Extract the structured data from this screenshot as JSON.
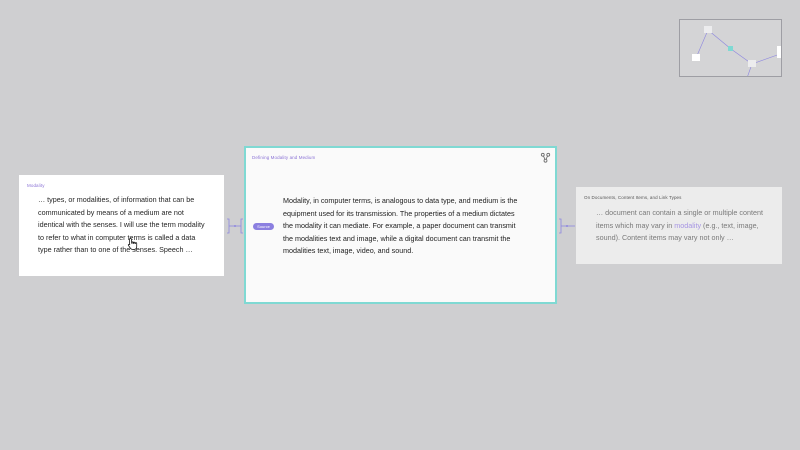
{
  "minimap": {
    "label": "document map"
  },
  "cards": {
    "left": {
      "title": "Modality",
      "body": "… types, or modalities, of information that can be communicated by means of a medium are not identical with the senses. I will use the term modality to refer to what in computer terms is called a data type rather than to one of the senses. Speech …"
    },
    "center": {
      "title": "Defining Modality and Medium",
      "source_label": "Source",
      "body": "Modality, in computer terms, is analogous to data type, and medium is the equipment used for its transmission. The properties of a medium dictates the modality it can mediate. For example, a paper document can transmit the modalities text and image, while a digital document can transmit the modalities text, image, video, and sound."
    },
    "right": {
      "title": "On Documents, Content Items, and Link Types",
      "body_before": "… document can contain a single or multiple content items which may vary in ",
      "body_link": "modality",
      "body_after": " (e.g., text, image, sound). Content items may vary not only …"
    }
  },
  "colors": {
    "background": "#cfcfd1",
    "accent": "#8c74d6",
    "selection": "#7fd9d3",
    "connector": "#8d86e0"
  },
  "icons": {
    "branch": "branch-icon",
    "cursor": "hand-cursor-icon"
  }
}
